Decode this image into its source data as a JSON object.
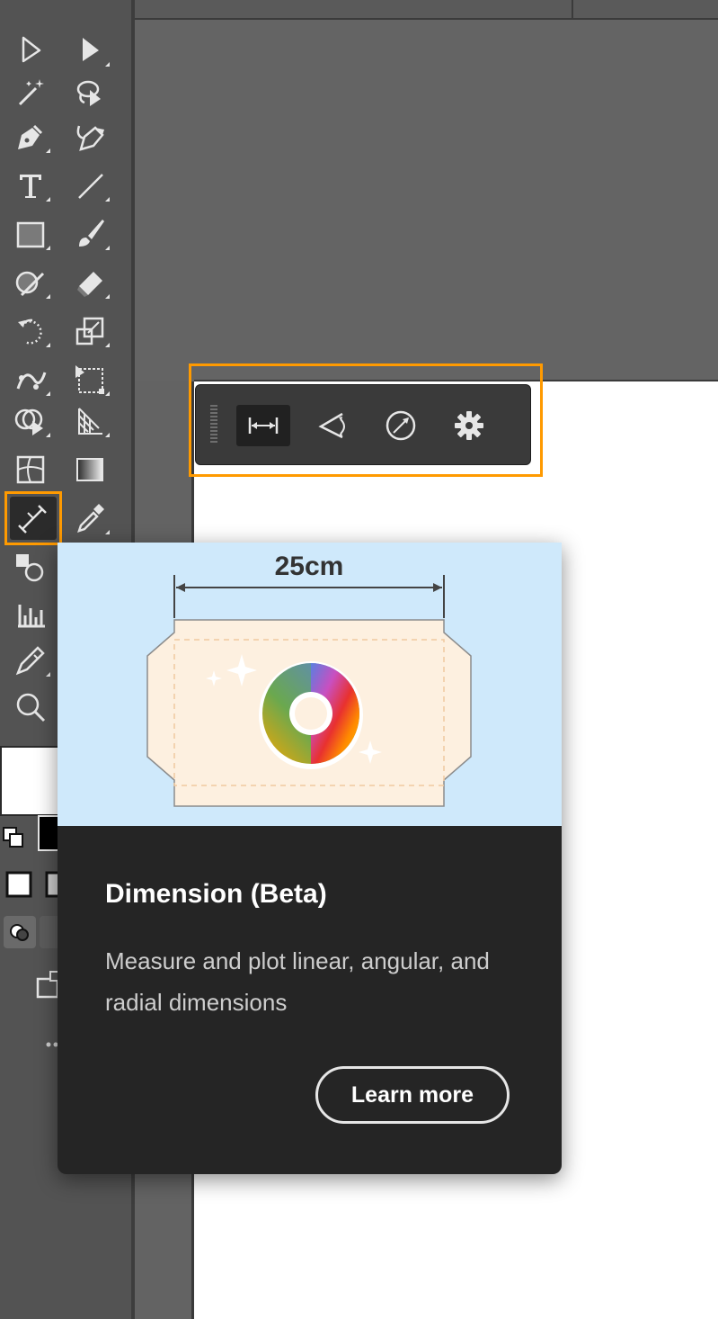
{
  "toolbar": {
    "tools": [
      {
        "name": "selection-tool-icon"
      },
      {
        "name": "direct-selection-tool-icon"
      },
      {
        "name": "magic-wand-tool-icon"
      },
      {
        "name": "lasso-tool-icon"
      },
      {
        "name": "pen-tool-icon"
      },
      {
        "name": "curvature-tool-icon"
      },
      {
        "name": "type-tool-icon"
      },
      {
        "name": "line-segment-tool-icon"
      },
      {
        "name": "rectangle-tool-icon"
      },
      {
        "name": "paintbrush-tool-icon"
      },
      {
        "name": "shaper-tool-icon"
      },
      {
        "name": "eraser-tool-icon"
      },
      {
        "name": "rotate-tool-icon"
      },
      {
        "name": "scale-tool-icon"
      },
      {
        "name": "puppet-warp-tool-icon"
      },
      {
        "name": "free-transform-tool-icon"
      },
      {
        "name": "shape-builder-tool-icon"
      },
      {
        "name": "perspective-grid-tool-icon"
      },
      {
        "name": "mesh-tool-icon"
      },
      {
        "name": "gradient-tool-icon"
      },
      {
        "name": "dimension-tool-icon",
        "selected": true
      },
      {
        "name": "eyedropper-tool-icon"
      },
      {
        "name": "blend-tool-icon"
      },
      {
        "name": "graph-tool-icon"
      },
      {
        "name": "artboard-tool-icon"
      },
      {
        "name": "zoom-tool-icon"
      }
    ],
    "fill_color": "#ffffff",
    "stroke_color": "#000000"
  },
  "context_bar": {
    "buttons": [
      {
        "name": "linear-dimension-icon",
        "selected": true
      },
      {
        "name": "angular-dimension-icon"
      },
      {
        "name": "radial-dimension-icon"
      },
      {
        "name": "settings-gear-icon"
      }
    ]
  },
  "tooltip": {
    "illustration": {
      "dimension_label": "25cm"
    },
    "title": "Dimension (Beta)",
    "description": "Measure and plot linear, angular, and radial dimensions",
    "button_label": "Learn more"
  },
  "colors": {
    "highlight": "#ff9a00",
    "panel": "#535353",
    "tooltip_bg": "#252525",
    "illustration_bg": "#cfe9fb"
  }
}
